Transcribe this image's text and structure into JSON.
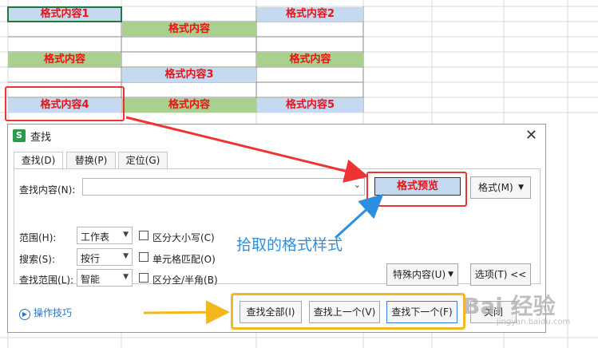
{
  "sheet": {
    "cells": [
      {
        "text": "格式内容1",
        "style": "blue",
        "selected": true
      },
      {
        "text": "格式内容2",
        "style": "blue"
      },
      {
        "text": "格式内容",
        "style": "green"
      },
      {
        "text": "格式内容",
        "style": "green"
      },
      {
        "text": "格式内容",
        "style": "green"
      },
      {
        "text": "格式内容3",
        "style": "blue"
      },
      {
        "text": "格式内容4",
        "style": "blue"
      },
      {
        "text": "格式内容",
        "style": "green"
      },
      {
        "text": "格式内容5",
        "style": "blue"
      }
    ]
  },
  "dialog": {
    "title": "查找",
    "app_icon": "S",
    "close": "✕",
    "tabs": [
      {
        "label": "查找(D)",
        "active": true
      },
      {
        "label": "替换(P)"
      },
      {
        "label": "定位(G)"
      }
    ],
    "find_label": "查找内容(N):",
    "find_value": "",
    "preview": "格式预览",
    "format_button": "格式(M)",
    "options": [
      {
        "label": "范围(H):",
        "value": "工作表",
        "check": "区分大小写(C)"
      },
      {
        "label": "搜索(S):",
        "value": "按行",
        "check": "单元格匹配(O)"
      },
      {
        "label": "查找范围(L):",
        "value": "智能",
        "check": "区分全/半角(B)"
      }
    ],
    "special_button": "特殊内容(U)",
    "options_button": "选项(T) <<",
    "find_all": "查找全部(I)",
    "find_prev": "查找上一个(V)",
    "find_next": "查找下一个(F)",
    "close_button": "关闭",
    "tips": "操作技巧"
  },
  "annotation": "拾取的格式样式",
  "watermark": "Bai 经验",
  "watermark_sub": "jingyan.baidu.com",
  "colors": {
    "accent_red": "#e33333",
    "accent_yellow": "#f3b81f",
    "accent_blue": "#2c8fe0",
    "cell_blue": "#c5d9f1",
    "cell_green": "#a9d08e"
  }
}
